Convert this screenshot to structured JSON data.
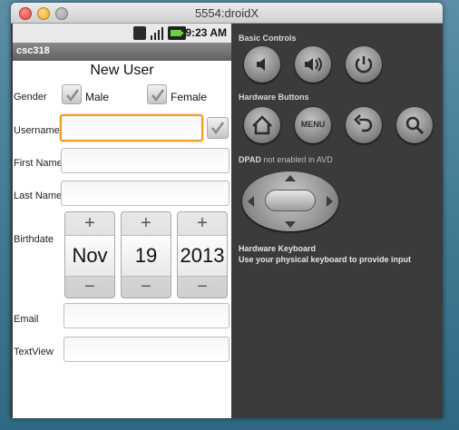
{
  "window": {
    "title": "5554:droidX"
  },
  "status_bar": {
    "time": "9:23 AM",
    "icons": [
      "3g-icon",
      "signal-icon",
      "battery-icon"
    ]
  },
  "app_bar": {
    "title": "csc318"
  },
  "form": {
    "title": "New User",
    "gender_label": "Gender",
    "male_label": "Male",
    "female_label": "Female",
    "username_label": "Username",
    "username_value": "",
    "first_name_label": "First Name",
    "first_name_value": "",
    "last_name_label": "Last Name",
    "last_name_value": "",
    "birthdate_label": "Birthdate",
    "birthdate": {
      "month": "Nov",
      "day": "19",
      "year": "2013",
      "plus": "+",
      "minus": "−"
    },
    "email_label": "Email",
    "email_value": "",
    "textview_label": "TextView",
    "textview_value": ""
  },
  "panel": {
    "basic_controls_title": "Basic Controls",
    "hardware_buttons_title": "Hardware Buttons",
    "menu_label": "MENU",
    "dpad_title": "DPAD",
    "dpad_status": "not enabled in AVD",
    "hardware_keyboard_title": "Hardware Keyboard",
    "hardware_keyboard_desc": "Use your physical keyboard to provide input"
  },
  "colors": {
    "focus_border": "#f29a22",
    "panel_bg": "#3b3b3b"
  }
}
